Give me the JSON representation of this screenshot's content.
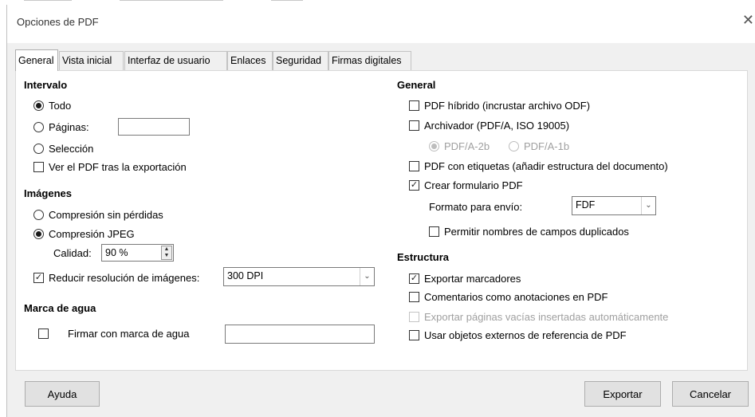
{
  "window": {
    "title": "Opciones de PDF",
    "close_glyph": "✕"
  },
  "tabs": [
    "General",
    "Vista inicial",
    "Interfaz de usuario",
    "Enlaces",
    "Seguridad",
    "Firmas digitales"
  ],
  "intervalo": {
    "header": "Intervalo",
    "todo": "Todo",
    "paginas": "Páginas:",
    "paginas_value": "",
    "seleccion": "Selección",
    "ver_pdf": "Ver el PDF tras la exportación"
  },
  "imagenes": {
    "header": "Imágenes",
    "sin_perdidas": "Compresión sin pérdidas",
    "jpeg": "Compresión JPEG",
    "calidad_label": "Calidad:",
    "calidad_value": "90 %",
    "reducir": "Reducir resolución de imágenes:",
    "resolucion_value": "300 DPI"
  },
  "marca": {
    "header": "Marca de agua",
    "firmar": "Firmar con marca de agua",
    "texto_value": ""
  },
  "general": {
    "header": "General",
    "hibrido": "PDF híbrido (incrustar archivo ODF)",
    "archivador": "Archivador (PDF/A, ISO 19005)",
    "pdfa2b": "PDF/A-2b",
    "pdfa1b": "PDF/A-1b",
    "etiquetas": "PDF con etiquetas (añadir estructura del documento)",
    "formulario": "Crear formulario PDF",
    "formato_label": "Formato para envío:",
    "formato_value": "FDF",
    "duplicados": "Permitir nombres de campos duplicados"
  },
  "estructura": {
    "header": "Estructura",
    "marcadores": "Exportar marcadores",
    "comentarios": "Comentarios como anotaciones en PDF",
    "vacias": "Exportar páginas vacías insertadas automáticamente",
    "externos": "Usar objetos externos de referencia de PDF"
  },
  "buttons": {
    "ayuda": "Ayuda",
    "exportar": "Exportar",
    "cancelar": "Cancelar"
  },
  "icons": {
    "check": "check-mark",
    "dropdown": "chevron-down",
    "spin_up": "triangle-up",
    "spin_down": "triangle-down"
  }
}
